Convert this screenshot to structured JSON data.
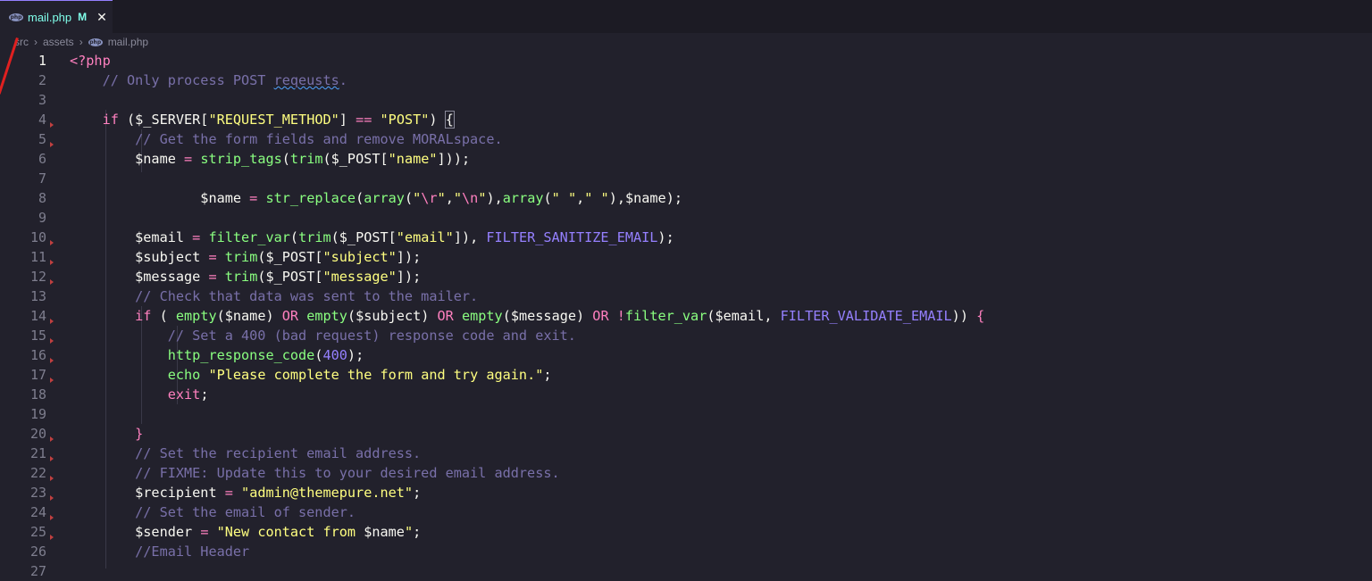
{
  "tab": {
    "filename": "mail.php",
    "status": "M",
    "close": "✕",
    "icon": "php-file-icon"
  },
  "breadcrumb": {
    "items": [
      "src",
      "assets",
      "mail.php"
    ],
    "separator": "›"
  },
  "editor": {
    "line_numbers": [
      "1",
      "2",
      "3",
      "4",
      "5",
      "6",
      "7",
      "8",
      "9",
      "10",
      "11",
      "12",
      "13",
      "14",
      "15",
      "16",
      "17",
      "18",
      "19",
      "20",
      "21",
      "22",
      "23",
      "24",
      "25",
      "26",
      "27"
    ],
    "lines": [
      [
        [
          "k",
          "<?php"
        ]
      ],
      [
        [
          "c",
          "    // Only process POST "
        ],
        [
          "c squig",
          "reqeusts"
        ],
        [
          "c",
          "."
        ]
      ],
      [],
      [
        [
          "v",
          "    "
        ],
        [
          "k",
          "if"
        ],
        [
          "p",
          " ($_SERVER["
        ],
        [
          "s",
          "\"REQUEST_METHOD\""
        ],
        [
          "p",
          "] "
        ],
        [
          "k",
          "=="
        ],
        [
          "p",
          " "
        ],
        [
          "s",
          "\"POST\""
        ],
        [
          "p",
          ") "
        ],
        [
          "p brk",
          "{"
        ]
      ],
      [
        [
          "c",
          "        // Get the form fields and remove MORALspace."
        ]
      ],
      [
        [
          "v",
          "        $name "
        ],
        [
          "k",
          "="
        ],
        [
          "p",
          " "
        ],
        [
          "f",
          "strip_tags"
        ],
        [
          "p",
          "("
        ],
        [
          "f",
          "trim"
        ],
        [
          "p",
          "($_POST["
        ],
        [
          "s",
          "\"name\""
        ],
        [
          "p",
          "]));"
        ]
      ],
      [],
      [
        [
          "v",
          "                $name "
        ],
        [
          "k",
          "="
        ],
        [
          "p",
          " "
        ],
        [
          "f",
          "str_replace"
        ],
        [
          "p",
          "("
        ],
        [
          "f",
          "array"
        ],
        [
          "p",
          "("
        ],
        [
          "s",
          "\""
        ],
        [
          "e",
          "\\r"
        ],
        [
          "s",
          "\""
        ],
        [
          "p",
          ","
        ],
        [
          "s",
          "\""
        ],
        [
          "e",
          "\\n"
        ],
        [
          "s",
          "\""
        ],
        [
          "p",
          "),"
        ],
        [
          "f",
          "array"
        ],
        [
          "p",
          "("
        ],
        [
          "s",
          "\" \""
        ],
        [
          "p",
          ","
        ],
        [
          "s",
          "\" \""
        ],
        [
          "p",
          "),$name);"
        ]
      ],
      [],
      [
        [
          "v",
          "        $email "
        ],
        [
          "k",
          "="
        ],
        [
          "p",
          " "
        ],
        [
          "f",
          "filter_var"
        ],
        [
          "p",
          "("
        ],
        [
          "f",
          "trim"
        ],
        [
          "p",
          "($_POST["
        ],
        [
          "s",
          "\"email\""
        ],
        [
          "p",
          "]), "
        ],
        [
          "cn",
          "FILTER_SANITIZE_EMAIL"
        ],
        [
          "p",
          ");"
        ]
      ],
      [
        [
          "v",
          "        $subject "
        ],
        [
          "k",
          "="
        ],
        [
          "p",
          " "
        ],
        [
          "f",
          "trim"
        ],
        [
          "p",
          "($_POST["
        ],
        [
          "s",
          "\"subject\""
        ],
        [
          "p",
          "]);"
        ]
      ],
      [
        [
          "v",
          "        $message "
        ],
        [
          "k",
          "="
        ],
        [
          "p",
          " "
        ],
        [
          "f",
          "trim"
        ],
        [
          "p",
          "($_POST["
        ],
        [
          "s",
          "\"message\""
        ],
        [
          "p",
          "]);"
        ]
      ],
      [
        [
          "c",
          "        // Check that data was sent to the mailer."
        ]
      ],
      [
        [
          "v",
          "        "
        ],
        [
          "k",
          "if"
        ],
        [
          "p",
          " ( "
        ],
        [
          "f",
          "empty"
        ],
        [
          "p",
          "($name) "
        ],
        [
          "k",
          "OR"
        ],
        [
          "p",
          " "
        ],
        [
          "f",
          "empty"
        ],
        [
          "p",
          "($subject) "
        ],
        [
          "k",
          "OR"
        ],
        [
          "p",
          " "
        ],
        [
          "f",
          "empty"
        ],
        [
          "p",
          "($message) "
        ],
        [
          "k",
          "OR"
        ],
        [
          "p",
          " "
        ],
        [
          "k",
          "!"
        ],
        [
          "f",
          "filter_var"
        ],
        [
          "p",
          "($email, "
        ],
        [
          "cn",
          "FILTER_VALIDATE_EMAIL"
        ],
        [
          "p",
          ")) "
        ],
        [
          "k",
          "{"
        ]
      ],
      [
        [
          "c",
          "            // Set a 400 (bad request) response code and exit."
        ]
      ],
      [
        [
          "v",
          "            "
        ],
        [
          "f",
          "http_response_code"
        ],
        [
          "p",
          "("
        ],
        [
          "n",
          "400"
        ],
        [
          "p",
          ");"
        ]
      ],
      [
        [
          "v",
          "            "
        ],
        [
          "f",
          "echo"
        ],
        [
          "p",
          " "
        ],
        [
          "s",
          "\"Please complete the form and try again.\""
        ],
        [
          "p",
          ";"
        ]
      ],
      [
        [
          "v",
          "            "
        ],
        [
          "k",
          "exit"
        ],
        [
          "p",
          ";"
        ]
      ],
      [],
      [
        [
          "v",
          "        "
        ],
        [
          "k",
          "}"
        ]
      ],
      [
        [
          "c",
          "        // Set the recipient email address."
        ]
      ],
      [
        [
          "c",
          "        // FIXME: Update this to your desired email address."
        ]
      ],
      [
        [
          "v",
          "        $recipient "
        ],
        [
          "k",
          "="
        ],
        [
          "p",
          " "
        ],
        [
          "s",
          "\"admin@themepure.net\""
        ],
        [
          "p",
          ";"
        ]
      ],
      [
        [
          "c",
          "        // Set the email of sender."
        ]
      ],
      [
        [
          "v",
          "        $sender "
        ],
        [
          "k",
          "="
        ],
        [
          "p",
          " "
        ],
        [
          "s",
          "\"New contact from "
        ],
        [
          "v",
          "$name"
        ],
        [
          "s",
          "\""
        ],
        [
          "p",
          ";"
        ]
      ],
      [
        [
          "c",
          "        //Email Header"
        ]
      ],
      []
    ]
  }
}
